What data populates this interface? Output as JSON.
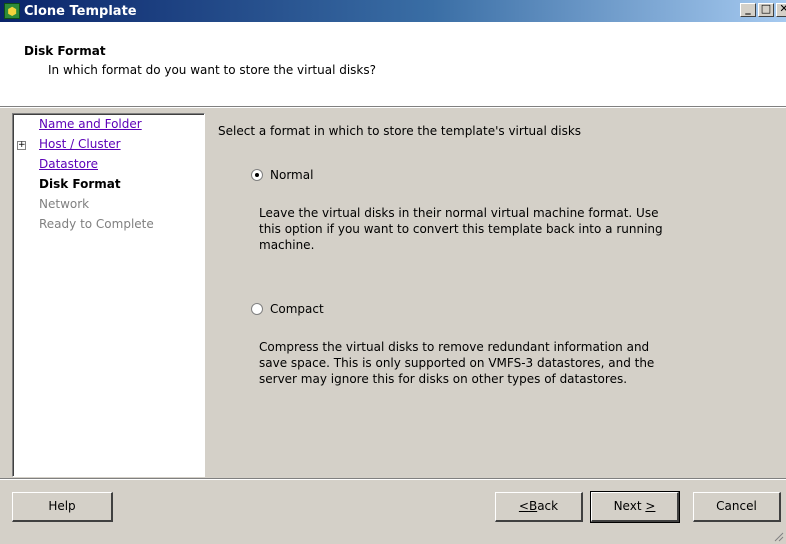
{
  "window": {
    "title": "Clone Template",
    "controls": [
      "minimize",
      "maximize",
      "close"
    ]
  },
  "header": {
    "title": "Disk Format",
    "subtitle": "In which format do you want to store the virtual disks?"
  },
  "nav": {
    "items": [
      {
        "label": "Name and Folder",
        "state": "link"
      },
      {
        "label": "Host / Cluster",
        "state": "link",
        "expandable": true
      },
      {
        "label": "Datastore",
        "state": "link"
      },
      {
        "label": "Disk Format",
        "state": "current"
      },
      {
        "label": "Network",
        "state": "disabled"
      },
      {
        "label": "Ready to Complete",
        "state": "disabled"
      }
    ]
  },
  "content": {
    "prompt": "Select a format in which to store the template's virtual disks",
    "options": [
      {
        "label": "Normal",
        "checked": true,
        "description": "Leave the virtual disks in their normal virtual machine format. Use this option if you want to convert this template back into a running machine."
      },
      {
        "label": "Compact",
        "checked": false,
        "description": "Compress the virtual disks to remove redundant information and save space. This is only supported on VMFS-3 datastores, and the server may ignore this for disks on other types of datastores."
      }
    ]
  },
  "buttons": {
    "help": "Help",
    "back_mnemonic": "B",
    "back_rest": "ack",
    "back_prefix": "<",
    "next_text": "Next ",
    "next_mnemonic": ">",
    "cancel": "Cancel"
  },
  "colors": {
    "title_bar": "#0a246a",
    "dialog_face": "#d4d0c8",
    "link": "#5c00b8",
    "disabled": "#808080"
  }
}
